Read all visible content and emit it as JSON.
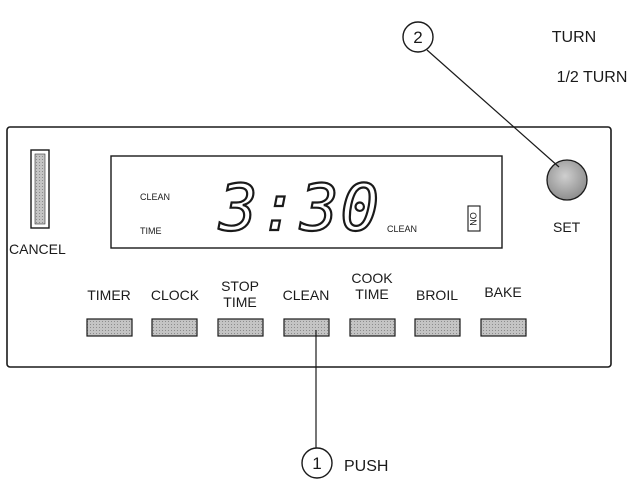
{
  "annotations": {
    "turn_line1": "TURN",
    "turn_line2": "1/2 TURN",
    "push": "PUSH",
    "step1_number": "1",
    "step2_number": "2"
  },
  "display": {
    "time": "3:30",
    "indicator_clean_top": "CLEAN",
    "indicator_time": "TIME",
    "indicator_clean_right": "CLEAN",
    "indicator_on": "ON"
  },
  "controls": {
    "cancel_label": "CANCEL",
    "set_label": "SET",
    "buttons": [
      {
        "line1": "TIMER",
        "line2": ""
      },
      {
        "line1": "CLOCK",
        "line2": ""
      },
      {
        "line1": "STOP",
        "line2": "TIME"
      },
      {
        "line1": "CLEAN",
        "line2": ""
      },
      {
        "line1": "COOK",
        "line2": "TIME"
      },
      {
        "line1": "BROIL",
        "line2": ""
      },
      {
        "line1": "BAKE",
        "line2": ""
      }
    ]
  },
  "colors": {
    "ink": "#1a1a1a",
    "button_fill": "#b9b9b9",
    "knob_fill": "#a8a8a8",
    "cancel_fill": "#9a9a9a"
  }
}
